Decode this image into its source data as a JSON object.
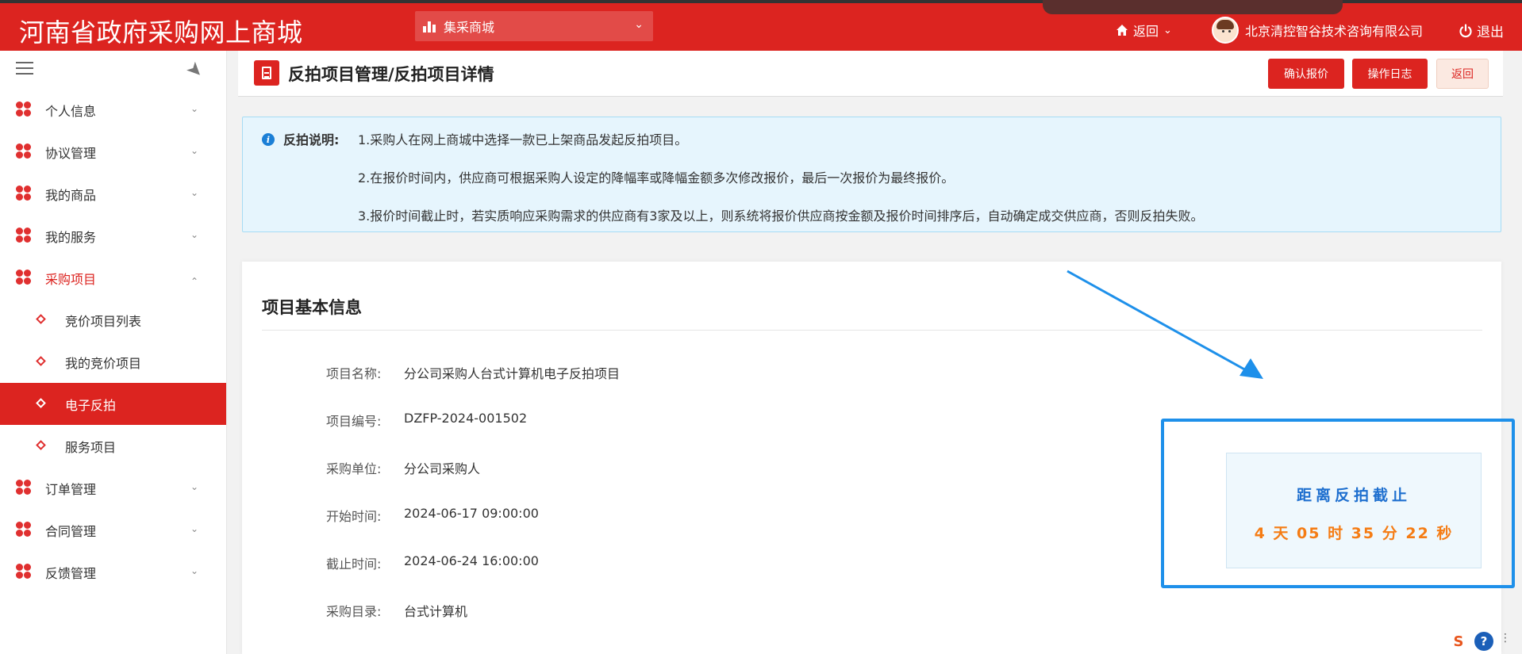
{
  "header": {
    "logo": "河南省政府采购网上商城",
    "mall_select": "集采商城",
    "back": "返回",
    "company": "北京清控智谷技术咨询有限公司",
    "logout": "退出"
  },
  "sidebar": {
    "items": [
      {
        "label": "个人信息"
      },
      {
        "label": "协议管理"
      },
      {
        "label": "我的商品"
      },
      {
        "label": "我的服务"
      },
      {
        "label": "采购项目"
      },
      {
        "label": "订单管理"
      },
      {
        "label": "合同管理"
      },
      {
        "label": "反馈管理"
      }
    ],
    "subitems": [
      {
        "label": "竞价项目列表"
      },
      {
        "label": "我的竞价项目"
      },
      {
        "label": "电子反拍"
      },
      {
        "label": "服务项目"
      }
    ]
  },
  "page": {
    "title": "反拍项目管理/反拍项目详情",
    "buttons": {
      "confirm": "确认报价",
      "log": "操作日志",
      "back": "返回"
    }
  },
  "notice": {
    "label": "反拍说明:",
    "lines": [
      "1.采购人在网上商城中选择一款已上架商品发起反拍项目。",
      "2.在报价时间内，供应商可根据采购人设定的降幅率或降幅金额多次修改报价，最后一次报价为最终报价。",
      "3.报价时间截止时，若实质响应采购需求的供应商有3家及以上，则系统将报价供应商按金额及报价时间排序后，自动确定成交供应商，否则反拍失败。"
    ]
  },
  "info": {
    "title": "项目基本信息",
    "fields": [
      {
        "label": "项目名称:",
        "value": "分公司采购人台式计算机电子反拍项目"
      },
      {
        "label": "项目编号:",
        "value": "DZFP-2024-001502"
      },
      {
        "label": "采购单位:",
        "value": "分公司采购人"
      },
      {
        "label": "开始时间:",
        "value": "2024-06-17 09:00:00"
      },
      {
        "label": "截止时间:",
        "value": "2024-06-24 16:00:00"
      },
      {
        "label": "采购目录:",
        "value": "台式计算机"
      }
    ]
  },
  "countdown": {
    "title": "距离反拍截止",
    "time": "4 天 05 时 35 分 22 秒"
  },
  "colors": {
    "brand_red": "#dc2420",
    "annotation_blue": "#1e90ea",
    "countdown_orange": "#f57c14"
  }
}
